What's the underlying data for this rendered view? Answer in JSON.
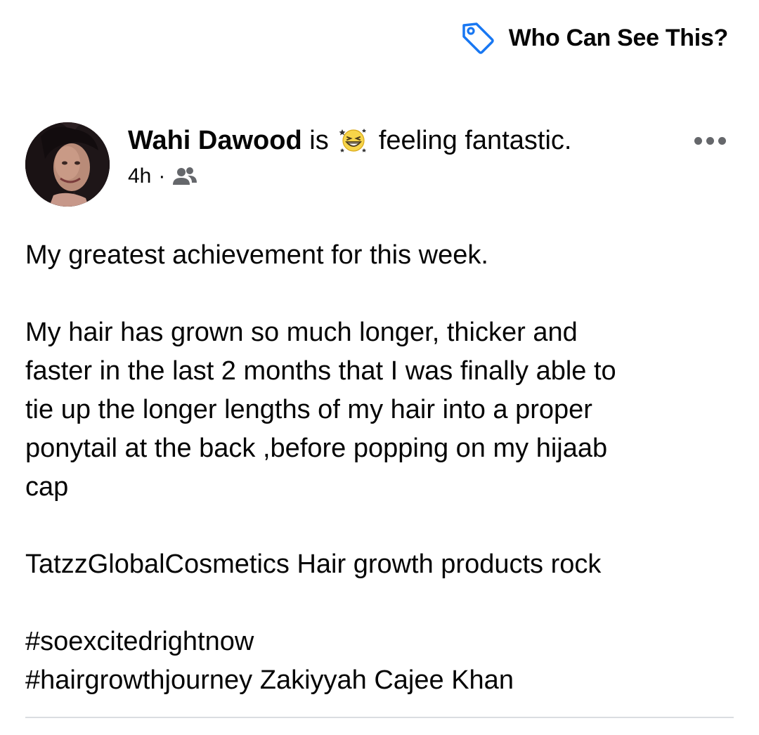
{
  "privacy": {
    "label": "Who Can See This?",
    "icon": "tag-icon",
    "icon_color": "#1877f2"
  },
  "post": {
    "author": "Wahi Dawood",
    "is_text": "is",
    "feeling_emoji": "grinning-squinting-face-icon",
    "feeling_text": "feeling fantastic.",
    "time": "4h",
    "separator": "·",
    "audience_icon": "friends-icon",
    "more_icon": "more-options-icon",
    "body": [
      "My greatest achievement for this week.",
      "",
      "My hair has grown so much longer, thicker and\nfaster in the last 2 months that I was finally able to\ntie up the longer lengths of my hair into a proper\nponytail at the back ,before popping on my hijaab\ncap",
      "",
      "TatzzGlobalCosmetics Hair growth products rock",
      "",
      "#soexcitedrightnow\n#hairgrowthjourney Zakiyyah Cajee Khan"
    ]
  }
}
